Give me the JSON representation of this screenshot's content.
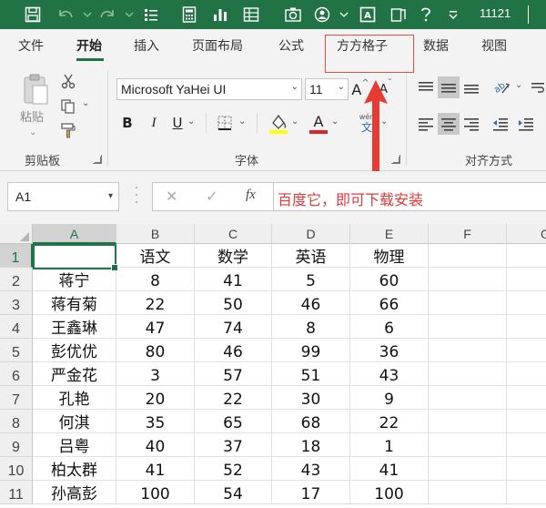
{
  "window": {
    "title": "11121"
  },
  "tabs": [
    {
      "label": "文件",
      "active": false
    },
    {
      "label": "开始",
      "active": true
    },
    {
      "label": "插入",
      "active": false
    },
    {
      "label": "页面布局",
      "active": false
    },
    {
      "label": "公式",
      "active": false
    },
    {
      "label": "方方格子",
      "active": false,
      "highlighted": true
    },
    {
      "label": "数据",
      "active": false
    },
    {
      "label": "视图",
      "active": false
    }
  ],
  "ribbon": {
    "clipboard": {
      "paste_label": "粘贴",
      "group_label": "剪贴板"
    },
    "font": {
      "font_name": "Microsoft YaHei UI",
      "font_size": "11",
      "bold": "B",
      "italic": "I",
      "underline": "U",
      "grow": "A",
      "shrink": "A",
      "phonetic_top": "wén",
      "phonetic_bottom": "文",
      "group_label": "字体",
      "font_color": "#d9262a",
      "highlight_color": "#ffff00"
    },
    "alignment": {
      "group_label": "对齐方式"
    }
  },
  "formula_bar": {
    "name_box": "A1",
    "cancel": "✕",
    "enter": "✓",
    "fx": "fx",
    "content": "百度它，即可下载安装"
  },
  "sheet": {
    "columns": [
      "A",
      "B",
      "C",
      "D",
      "E",
      "F",
      "G"
    ],
    "rows": [
      {
        "num": "1",
        "cells": [
          "",
          "语文",
          "数学",
          "英语",
          "物理",
          "",
          ""
        ]
      },
      {
        "num": "2",
        "cells": [
          "蒋宁",
          "8",
          "41",
          "5",
          "60",
          "",
          ""
        ]
      },
      {
        "num": "3",
        "cells": [
          "蒋有菊",
          "22",
          "50",
          "46",
          "66",
          "",
          ""
        ]
      },
      {
        "num": "4",
        "cells": [
          "王鑫琳",
          "47",
          "74",
          "8",
          "6",
          "",
          ""
        ]
      },
      {
        "num": "5",
        "cells": [
          "彭优优",
          "80",
          "46",
          "99",
          "36",
          "",
          ""
        ]
      },
      {
        "num": "6",
        "cells": [
          "严金花",
          "3",
          "57",
          "51",
          "43",
          "",
          ""
        ]
      },
      {
        "num": "7",
        "cells": [
          "孔艳",
          "20",
          "22",
          "30",
          "9",
          "",
          ""
        ]
      },
      {
        "num": "8",
        "cells": [
          "何淇",
          "35",
          "65",
          "68",
          "22",
          "",
          ""
        ]
      },
      {
        "num": "9",
        "cells": [
          "吕粤",
          "40",
          "37",
          "18",
          "1",
          "",
          ""
        ]
      },
      {
        "num": "10",
        "cells": [
          "柏太群",
          "41",
          "52",
          "43",
          "41",
          "",
          ""
        ]
      },
      {
        "num": "11",
        "cells": [
          "孙高彭",
          "100",
          "54",
          "17",
          "100",
          "",
          ""
        ]
      }
    ]
  },
  "colors": {
    "excel_green": "#217346",
    "annotation_red": "#e74c3c"
  }
}
